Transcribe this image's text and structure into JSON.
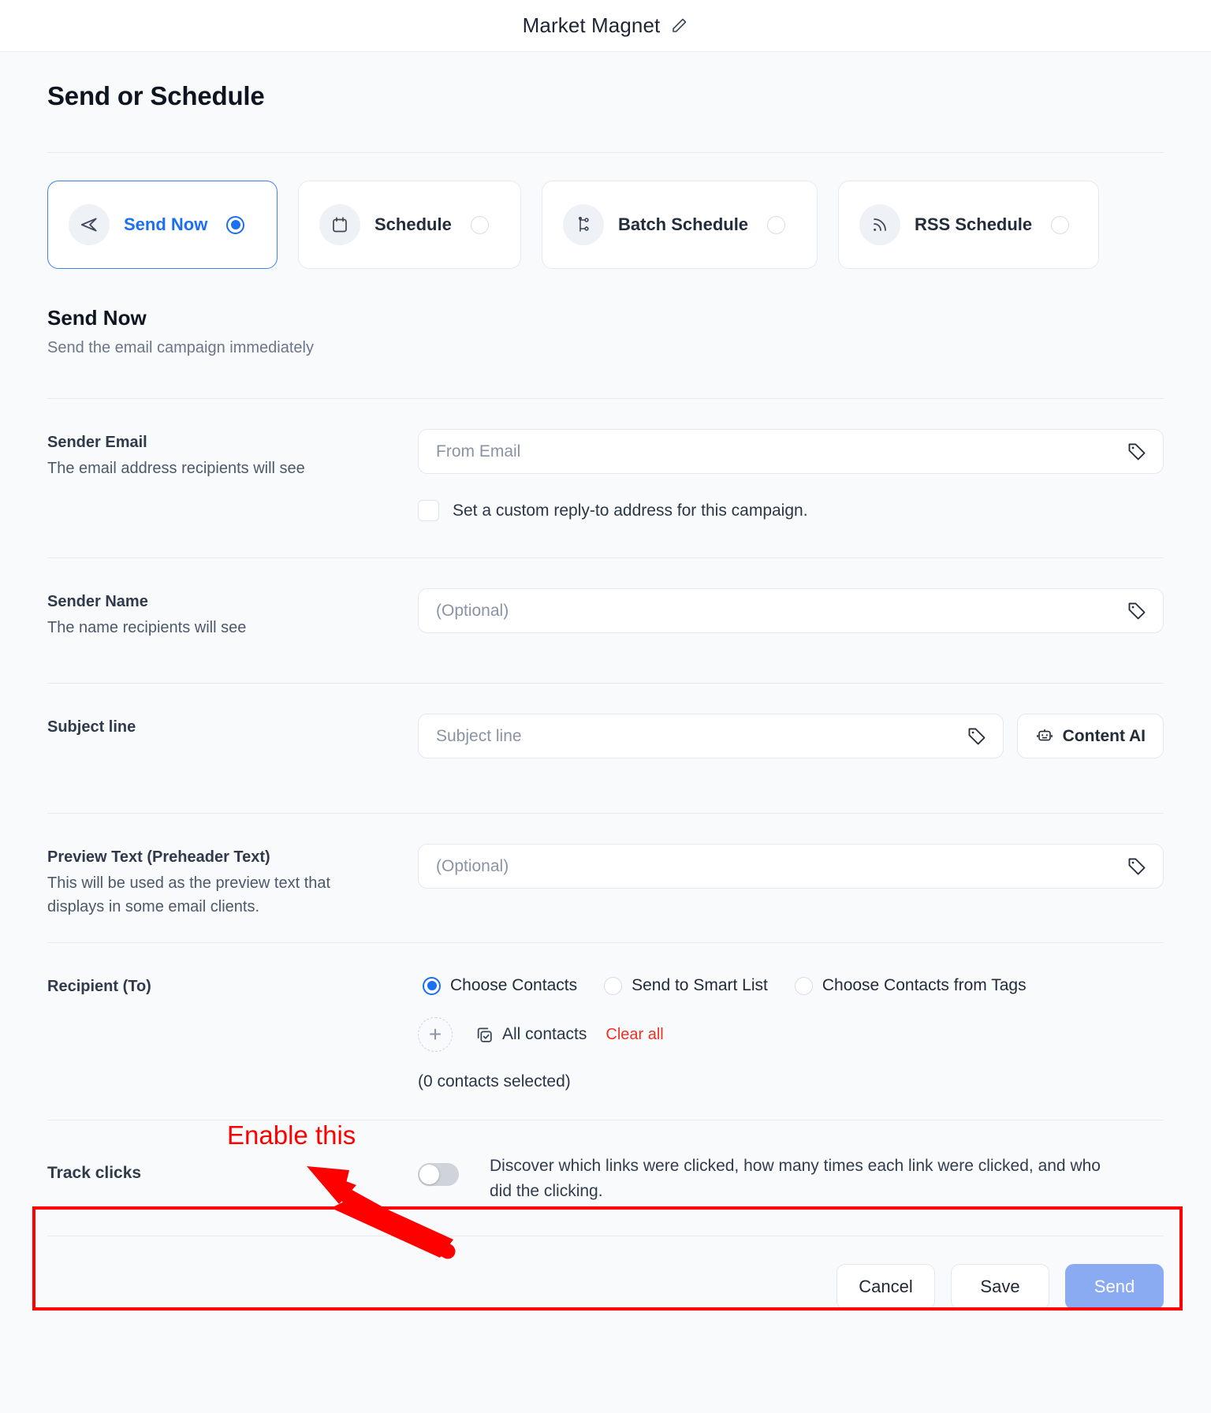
{
  "window": {
    "title": "Market Magnet",
    "edit_icon": "pencil-icon"
  },
  "page": {
    "heading": "Send or Schedule"
  },
  "modes": [
    {
      "label": "Send Now",
      "icon": "send-plane-icon",
      "selected": true
    },
    {
      "label": "Schedule",
      "icon": "calendar-icon",
      "selected": false
    },
    {
      "label": "Batch Schedule",
      "icon": "branch-icon",
      "selected": false
    },
    {
      "label": "RSS Schedule",
      "icon": "rss-icon",
      "selected": false
    }
  ],
  "mode_description": {
    "title": "Send Now",
    "subtitle": "Send the email campaign immediately"
  },
  "fields": {
    "sender_email": {
      "label": "Sender Email",
      "sublabel": "The email address recipients will see",
      "placeholder": "From Email",
      "value": "",
      "tag_icon": "tag-icon",
      "checkbox_label": "Set a custom reply-to address for this campaign.",
      "checkbox_checked": false
    },
    "sender_name": {
      "label": "Sender Name",
      "sublabel": "The name recipients will see",
      "placeholder": "(Optional)",
      "value": "",
      "tag_icon": "tag-icon"
    },
    "subject_line": {
      "label": "Subject line",
      "placeholder": "Subject line",
      "value": "",
      "tag_icon": "tag-icon",
      "content_ai_label": "Content AI",
      "content_ai_icon": "robot-icon"
    },
    "preview_text": {
      "label": "Preview Text (Preheader Text)",
      "sublabel": "This will be used as the preview text that displays in some email clients.",
      "placeholder": "(Optional)",
      "value": "",
      "tag_icon": "tag-icon"
    },
    "recipient": {
      "label": "Recipient (To)",
      "options": [
        {
          "label": "Choose Contacts",
          "selected": true
        },
        {
          "label": "Send to Smart List",
          "selected": false
        },
        {
          "label": "Choose Contacts from Tags",
          "selected": false
        }
      ],
      "add_icon": "plus-icon",
      "all_contacts_label": "All contacts",
      "all_contacts_icon": "copy-check-icon",
      "clear_all_label": "Clear all",
      "selected_count_text": "(0 contacts selected)"
    },
    "track_clicks": {
      "label": "Track clicks",
      "toggle_on": false,
      "description": "Discover which links were clicked, how many times each link were clicked, and who did the clicking."
    }
  },
  "footer": {
    "cancel_label": "Cancel",
    "save_label": "Save",
    "send_label": "Send"
  },
  "annotation": {
    "text": "Enable this",
    "color": "#ff0000"
  },
  "colors": {
    "accent": "#1d6ff2",
    "danger": "#ef3124",
    "primary_button": "#8aabf2",
    "annotation": "#ff0000",
    "page_bg": "#f8fafc"
  }
}
